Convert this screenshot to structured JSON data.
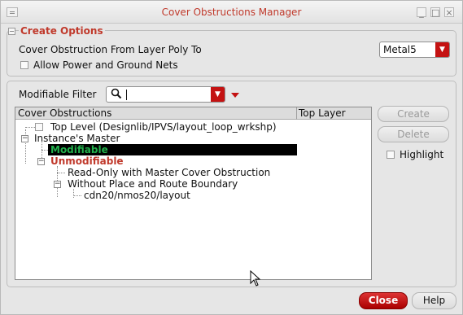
{
  "window": {
    "title": "Cover Obstructions Manager",
    "controls": [
      "minimize-icon",
      "maximize-icon",
      "close-icon"
    ]
  },
  "create_options": {
    "legend": "Create Options",
    "cover_label": "Cover Obstruction From Layer Poly To",
    "layer_value": "Metal5",
    "allow_power_label": "Allow Power and Ground Nets",
    "allow_power_checked": false
  },
  "filter": {
    "label": "Modifiable Filter",
    "value": ""
  },
  "tree": {
    "col_cover": "Cover Obstructions",
    "col_layer": "Top Layer",
    "rows": [
      {
        "label": "Top Level (Designlib/IPVS/layout_loop_wrkshp)"
      },
      {
        "label": "Instance's Master"
      },
      {
        "label": "Modifiable",
        "color": "#22b14c",
        "selected": true
      },
      {
        "label": "Unmodifiable",
        "color": "#c0392b"
      },
      {
        "label": "Read-Only with Master Cover Obstruction"
      },
      {
        "label": "Without Place and Route Boundary"
      },
      {
        "label": "cdn20/nmos20/layout"
      }
    ]
  },
  "buttons": {
    "create": "Create",
    "delete": "Delete",
    "highlight": "Highlight",
    "close": "Close",
    "help": "Help"
  }
}
